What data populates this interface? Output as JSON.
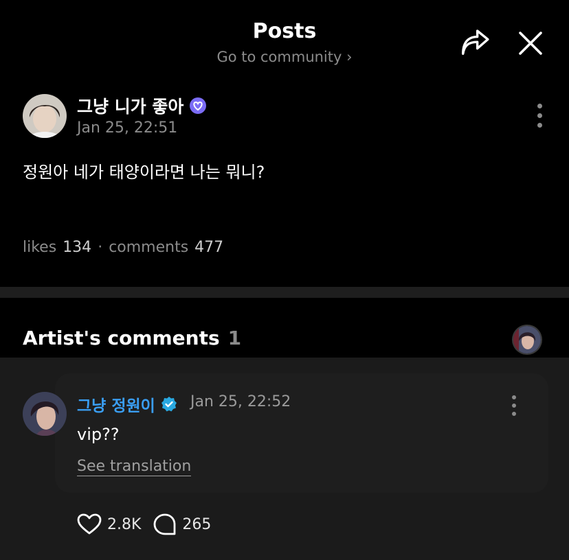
{
  "header": {
    "title": "Posts",
    "subtitle": "Go to community",
    "subtitle_chevron": "›",
    "icons": {
      "share": "share-icon",
      "close": "close-icon"
    }
  },
  "post": {
    "author": "그냥 니가 좋아",
    "verified_badge": "purple-heart-badge",
    "date": "Jan 25, 22:51",
    "body": "정원아 네가 태양이라면 나는 뭐니?",
    "likes_label": "likes",
    "likes_count": "134",
    "separator": "·",
    "comments_label": "comments",
    "comments_count": "477"
  },
  "artist_comments": {
    "heading": "Artist's comments",
    "count": "1",
    "comment": {
      "author": "그냥 정원이",
      "verified_badge": "blue-check-badge",
      "date": "Jan 25, 22:52",
      "text": "vip??",
      "translate_label": "See translation",
      "likes": "2.8K",
      "replies": "265"
    }
  },
  "colors": {
    "background": "#000000",
    "divider": "#1e1e1e",
    "panel": "#1b1b1b",
    "muted_text": "#8b8b8b",
    "artist_name": "#3a9ef3",
    "badge_purple": "#7b6cf6",
    "badge_blue": "#29a8e0"
  }
}
